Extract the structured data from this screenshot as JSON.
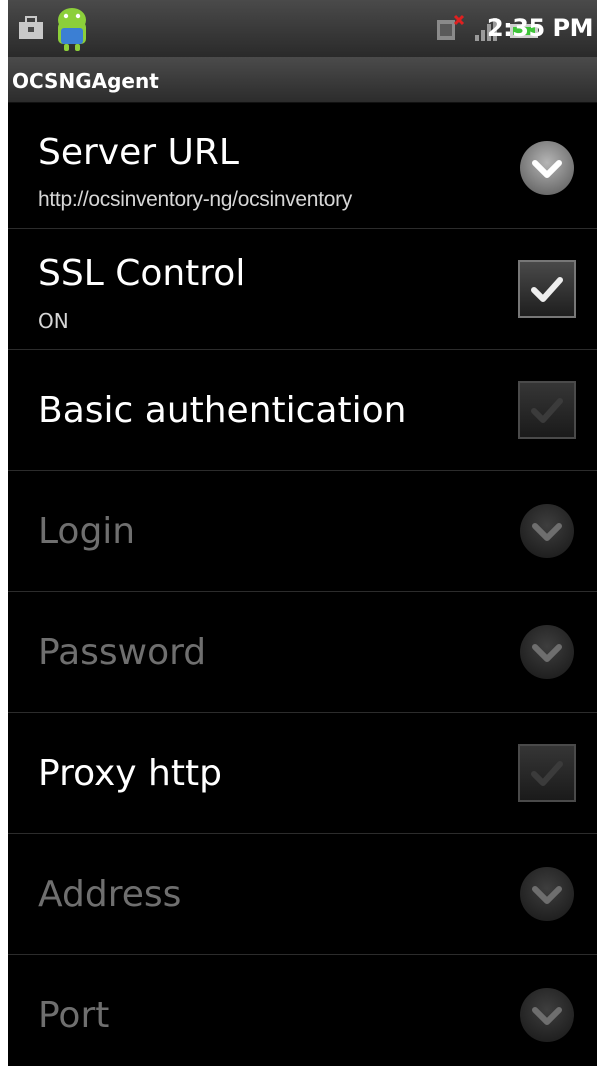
{
  "status_bar": {
    "time": "2:35 PM",
    "icons": [
      "shopping-bag-icon",
      "android-icon",
      "no-sim-icon",
      "signal-icon",
      "battery-icon"
    ]
  },
  "app": {
    "title": "OCSNGAgent"
  },
  "preferences": [
    {
      "title": "Server URL",
      "summary": "http://ocsinventory-ng/ocsinventory",
      "widget": "chevron-down-icon",
      "enabled": true
    },
    {
      "title": "SSL Control",
      "summary": "ON",
      "widget": "checkbox",
      "checked": true,
      "enabled": true
    },
    {
      "title": "Basic authentication",
      "widget": "checkbox",
      "checked": false,
      "enabled": true
    },
    {
      "title": "Login",
      "widget": "chevron-down-icon",
      "enabled": false
    },
    {
      "title": "Password",
      "widget": "chevron-down-icon",
      "enabled": false
    },
    {
      "title": "Proxy http",
      "widget": "checkbox",
      "checked": false,
      "enabled": true
    },
    {
      "title": "Address",
      "widget": "chevron-down-icon",
      "enabled": false
    },
    {
      "title": "Port",
      "widget": "chevron-down-icon",
      "enabled": false
    }
  ],
  "colors": {
    "background": "#000000",
    "text_enabled": "#ffffff",
    "text_disabled": "#6f6f6f",
    "bar_gradient_top": "#4a4a4a",
    "bar_gradient_bottom": "#2a2a2a"
  }
}
